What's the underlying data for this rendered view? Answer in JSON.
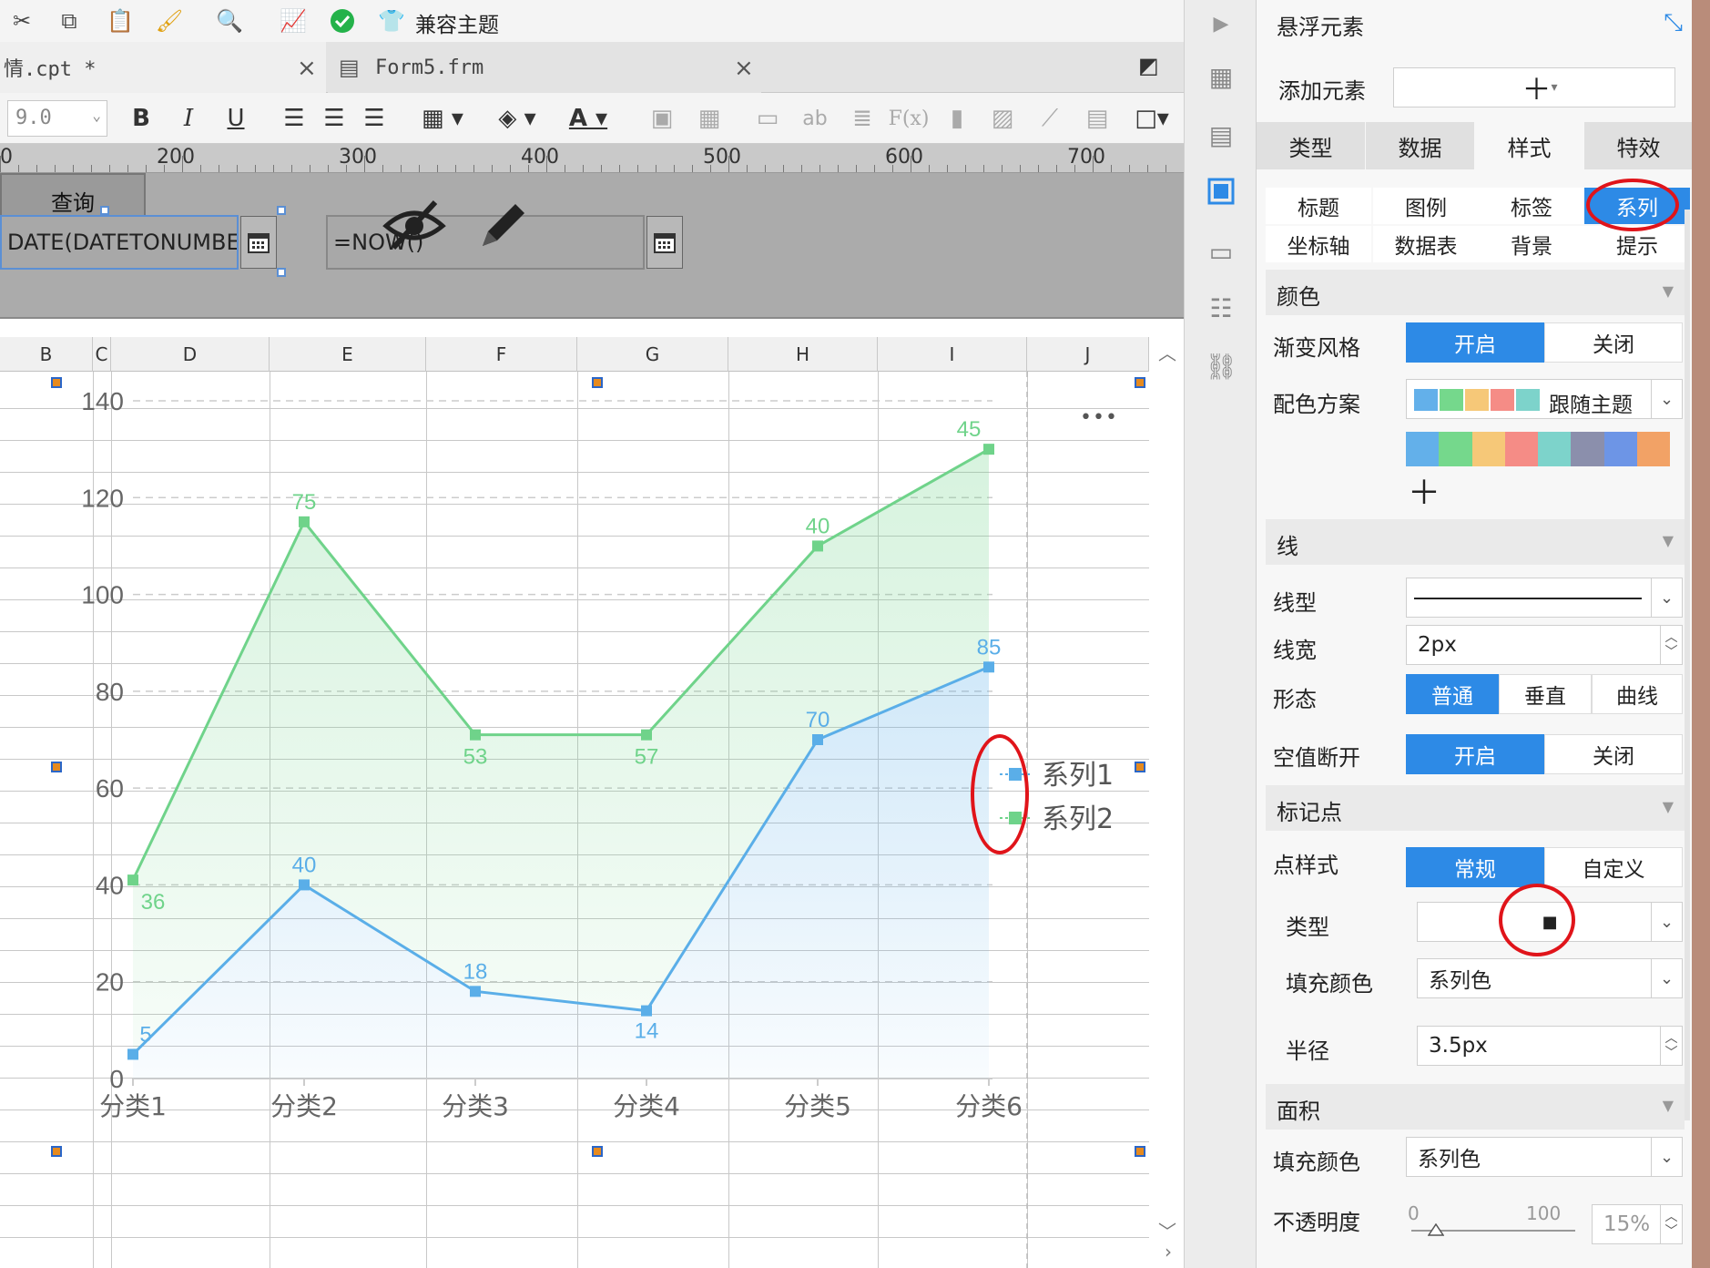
{
  "toolbar": {
    "compat_label": "兼容主题"
  },
  "tabs": [
    {
      "label": "情.cpt *"
    },
    {
      "label": "Form5.frm"
    }
  ],
  "format": {
    "font_size": "9.0",
    "bold": "B",
    "italic": "I",
    "underline": "U",
    "font_color": "A",
    "ab_label": "ab",
    "fx_label": "F(x)"
  },
  "ruler": {
    "labels": [
      "0",
      "200",
      "300",
      "400",
      "500",
      "600",
      "700"
    ]
  },
  "params": {
    "field1_value": "DATE(DATETONUMBER",
    "field2_value": "=NOW()",
    "query_button": "查询"
  },
  "grid": {
    "columns": [
      "B",
      "C",
      "D",
      "E",
      "F",
      "G",
      "H",
      "I",
      "J"
    ]
  },
  "chart_data": {
    "type": "area",
    "categories": [
      "分类1",
      "分类2",
      "分类3",
      "分类4",
      "分类5",
      "分类6"
    ],
    "ylim": [
      0,
      140
    ],
    "yticks": [
      0,
      20,
      40,
      60,
      80,
      100,
      120,
      140
    ],
    "series": [
      {
        "name": "系列1",
        "color": "#5aaee8",
        "values": [
          5,
          40,
          18,
          14,
          70,
          85
        ]
      },
      {
        "name": "系列2",
        "color": "#6fd38a",
        "values": [
          36,
          75,
          53,
          57,
          40,
          45
        ]
      }
    ],
    "stacked": true,
    "data_labels": true,
    "legend": "right",
    "more_label": "•••"
  },
  "panel": {
    "title": "悬浮元素",
    "add_element_label": "添加元素",
    "main_tabs": [
      "类型",
      "数据",
      "样式",
      "特效"
    ],
    "active_main_tab": "样式",
    "sub_tabs": [
      "标题",
      "图例",
      "标签",
      "系列",
      "坐标轴",
      "数据表",
      "背景",
      "提示"
    ],
    "active_sub_tab": "系列",
    "color_section": {
      "title": "颜色",
      "gradient_label": "渐变风格",
      "gradient_on": "开启",
      "gradient_off": "关闭",
      "scheme_label": "配色方案",
      "scheme_value": "跟随主题",
      "palette": [
        "#63b0ea",
        "#75d88c",
        "#f6c878",
        "#f58c86",
        "#7dd3cb",
        "#8b8fac",
        "#6d95e6",
        "#f2a266"
      ]
    },
    "line_section": {
      "title": "线",
      "type_label": "线型",
      "width_label": "线宽",
      "width_value": "2px",
      "shape_label": "形态",
      "shape_options": [
        "普通",
        "垂直",
        "曲线"
      ],
      "null_break_label": "空值断开",
      "null_on": "开启",
      "null_off": "关闭"
    },
    "marker_section": {
      "title": "标记点",
      "style_label": "点样式",
      "style_options": [
        "常规",
        "自定义"
      ],
      "type_label": "类型",
      "type_value": "■",
      "fill_label": "填充颜色",
      "fill_value": "系列色",
      "radius_label": "半径",
      "radius_value": "3.5px"
    },
    "area_section": {
      "title": "面积",
      "fill_label": "填充颜色",
      "fill_value": "系列色",
      "opacity_label": "不透明度",
      "opacity_min": "0",
      "opacity_max": "100",
      "opacity_value": "15%"
    }
  }
}
